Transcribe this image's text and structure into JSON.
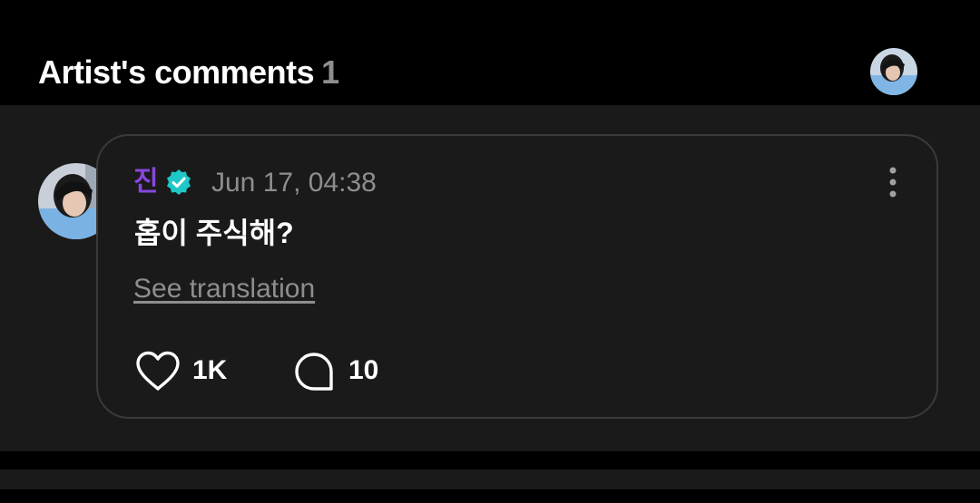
{
  "header": {
    "title": "Artist's comments",
    "count": "1"
  },
  "comment": {
    "author": "진",
    "timestamp": "Jun 17, 04:38",
    "text": "홉이 주식해?",
    "translate_label": "See translation",
    "likes": "1K",
    "replies": "10"
  },
  "icons": {
    "verified": "verified-badge-icon",
    "more": "more-vertical-icon",
    "like": "heart-icon",
    "reply": "comment-bubble-icon"
  },
  "colors": {
    "author_name": "#8a46e0",
    "verified_badge": "#1fc8c8",
    "muted_text": "#8e8e8e",
    "panel_bg": "#1a1a1a",
    "card_border": "#3a3a3a"
  }
}
